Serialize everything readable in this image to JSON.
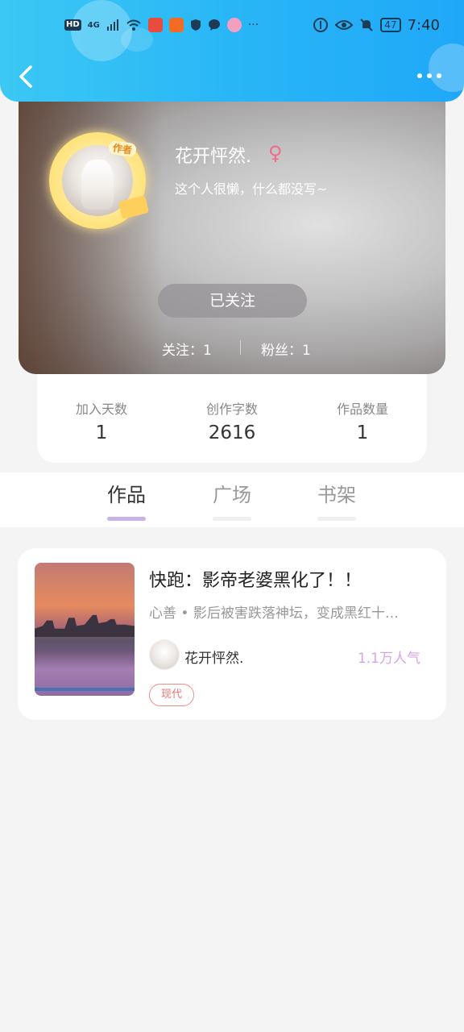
{
  "status_bar": {
    "left_text_hd": "HD",
    "left_text_4g": "4G",
    "battery": "47",
    "time": "7:40",
    "more": "···"
  },
  "nav": {
    "back_icon": "chevron-left-icon",
    "more_icon": "more-dots-icon"
  },
  "profile": {
    "badge": "作者",
    "name": "花开怦然.",
    "gender_symbol": "♀",
    "bio": "这个人很懒，什么都没写~",
    "follow_button": "已关注",
    "following_label": "关注：",
    "following_count": "1",
    "fans_label": "粉丝：",
    "fans_count": "1"
  },
  "stats": [
    {
      "label": "加入天数",
      "value": "1"
    },
    {
      "label": "创作字数",
      "value": "2616"
    },
    {
      "label": "作品数量",
      "value": "1"
    }
  ],
  "tabs": [
    {
      "label": "作品",
      "active": true
    },
    {
      "label": "广场",
      "active": false
    },
    {
      "label": "书架",
      "active": false
    }
  ],
  "works": [
    {
      "title": "快跑：影帝老婆黑化了！！",
      "description": "心善 • 影后被害跌落神坛，变成黑红十…",
      "author": "花开怦然.",
      "popularity": "1.1万人气",
      "genre": "现代"
    }
  ],
  "colors": {
    "header_start": "#3cc8f4",
    "header_end": "#1fa8f8",
    "tab_active_underline": "#c9b2e8",
    "popularity": "#d4a6e6",
    "genre_border": "#f08a86",
    "female": "#f06c8c"
  }
}
